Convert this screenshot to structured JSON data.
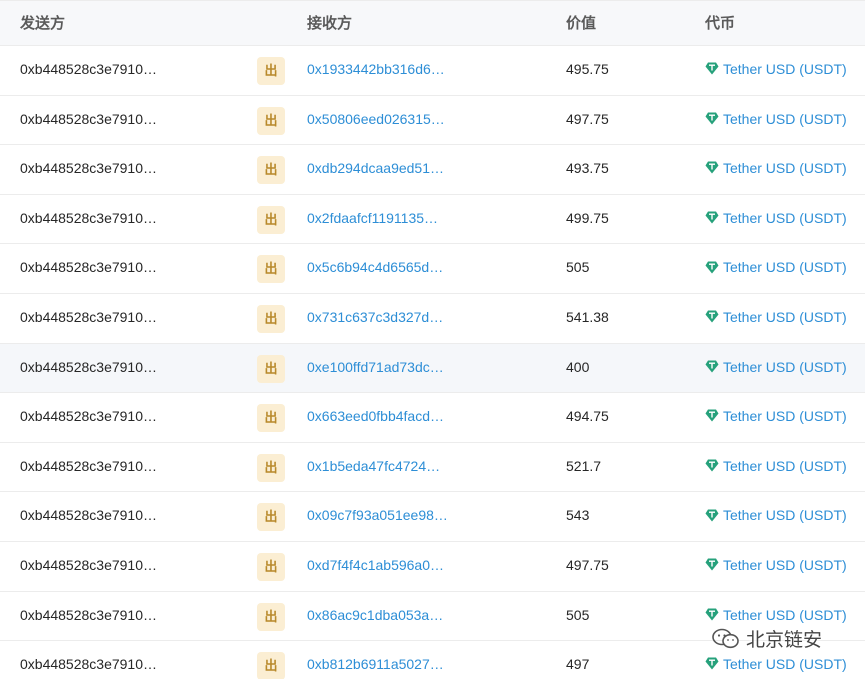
{
  "table": {
    "headers": {
      "from": "发送方",
      "to": "接收方",
      "value": "价值",
      "token": "代币"
    },
    "rows": [
      {
        "from": "0xb448528c3e7910…",
        "direction": "出",
        "to": "0x1933442bb316d6…",
        "value": "495.75",
        "token": "Tether USD (USDT)"
      },
      {
        "from": "0xb448528c3e7910…",
        "direction": "出",
        "to": "0x50806eed026315…",
        "value": "497.75",
        "token": "Tether USD (USDT)"
      },
      {
        "from": "0xb448528c3e7910…",
        "direction": "出",
        "to": "0xdb294dcaa9ed51…",
        "value": "493.75",
        "token": "Tether USD (USDT)"
      },
      {
        "from": "0xb448528c3e7910…",
        "direction": "出",
        "to": "0x2fdaafcf1191135…",
        "value": "499.75",
        "token": "Tether USD (USDT)"
      },
      {
        "from": "0xb448528c3e7910…",
        "direction": "出",
        "to": "0x5c6b94c4d6565d…",
        "value": "505",
        "token": "Tether USD (USDT)"
      },
      {
        "from": "0xb448528c3e7910…",
        "direction": "出",
        "to": "0x731c637c3d327d…",
        "value": "541.38",
        "token": "Tether USD (USDT)"
      },
      {
        "from": "0xb448528c3e7910…",
        "direction": "出",
        "to": "0xe100ffd71ad73dc…",
        "value": "400",
        "token": "Tether USD (USDT)"
      },
      {
        "from": "0xb448528c3e7910…",
        "direction": "出",
        "to": "0x663eed0fbb4facd…",
        "value": "494.75",
        "token": "Tether USD (USDT)"
      },
      {
        "from": "0xb448528c3e7910…",
        "direction": "出",
        "to": "0x1b5eda47fc4724…",
        "value": "521.7",
        "token": "Tether USD (USDT)"
      },
      {
        "from": "0xb448528c3e7910…",
        "direction": "出",
        "to": "0x09c7f93a051ee98…",
        "value": "543",
        "token": "Tether USD (USDT)"
      },
      {
        "from": "0xb448528c3e7910…",
        "direction": "出",
        "to": "0xd7f4f4c1ab596a0…",
        "value": "497.75",
        "token": "Tether USD (USDT)"
      },
      {
        "from": "0xb448528c3e7910…",
        "direction": "出",
        "to": "0x86ac9c1dba053a…",
        "value": "505",
        "token": "Tether USD (USDT)"
      },
      {
        "from": "0xb448528c3e7910…",
        "direction": "出",
        "to": "0xb812b6911a5027…",
        "value": "497",
        "token": "Tether USD (USDT)"
      }
    ],
    "highlighted_row": 6,
    "token_icon": "tether-icon",
    "colors": {
      "link": "#2d8ed6",
      "direction_badge_bg": "#fbeed3",
      "direction_badge_text": "#b8892b",
      "tether": "#26a17b"
    }
  },
  "watermark": {
    "text": "北京链安",
    "icon": "wechat-icon"
  }
}
